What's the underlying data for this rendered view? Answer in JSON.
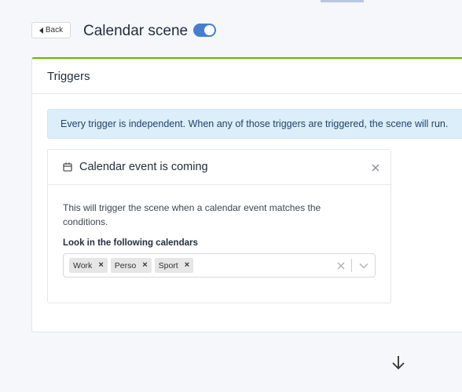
{
  "header": {
    "back_label": "Back",
    "title": "Calendar scene",
    "enabled": true
  },
  "triggers_card": {
    "title": "Triggers",
    "info_text": "Every trigger is independent. When any of those triggers are triggered, the scene will run."
  },
  "trigger": {
    "title": "Calendar event is coming",
    "description": "This will trigger the scene when a calendar event matches the conditions.",
    "calendars_label": "Look in the following calendars",
    "selected_calendars": [
      "Work",
      "Perso",
      "Sport"
    ]
  },
  "icons": {
    "back": "back-triangle-icon",
    "trigger": "calendar-icon",
    "close": "close-icon",
    "clear": "clear-icon",
    "dropdown": "chevron-down-icon",
    "next": "arrow-down-icon"
  },
  "colors": {
    "accent": "#467fcf",
    "card_top_border": "#5eba00",
    "info_bg": "#dbeef9"
  }
}
